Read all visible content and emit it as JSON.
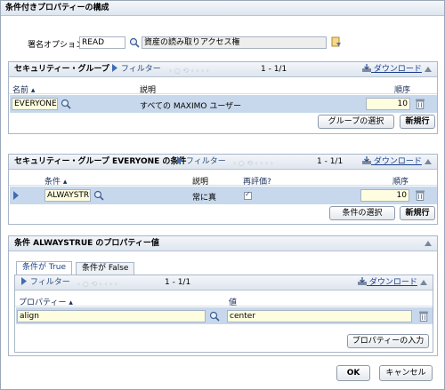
{
  "dialog": {
    "title": "条件付きプロパティーの構成",
    "signature_label": "署名オプション:",
    "signature_value": "READ",
    "signature_desc": "資産の読み取りアクセス権"
  },
  "common": {
    "filter": "フィルター",
    "download": "ダウンロード",
    "pager": "1 - 1/1"
  },
  "groups": {
    "title": "セキュリティー・グループ",
    "columns": {
      "name": "名前",
      "desc": "説明",
      "seq": "順序"
    },
    "rows": [
      {
        "name": "EVERYONE",
        "desc": "すべての MAXIMO ユーザー",
        "seq": "10"
      }
    ],
    "select_btn": "グループの選択",
    "new_btn": "新規行"
  },
  "conditions": {
    "title": "セキュリティー・グループ EVERYONE の条件",
    "columns": {
      "cond": "条件",
      "desc": "説明",
      "reeval": "再評価?",
      "seq": "順序"
    },
    "rows": [
      {
        "cond": "ALWAYSTRU",
        "desc": "常に真",
        "seq": "10"
      }
    ],
    "select_btn": "条件の選択",
    "new_btn": "新規行"
  },
  "props": {
    "title": "条件 ALWAYSTRUE のプロパティー値",
    "tabs": [
      "条件が True",
      "条件が False"
    ],
    "columns": {
      "prop": "プロパティー",
      "value": "値"
    },
    "rows": [
      {
        "prop": "align",
        "value": "center"
      }
    ],
    "enter_btn": "プロパティーの入力"
  },
  "footer": {
    "ok": "OK",
    "cancel": "キャンセル"
  }
}
